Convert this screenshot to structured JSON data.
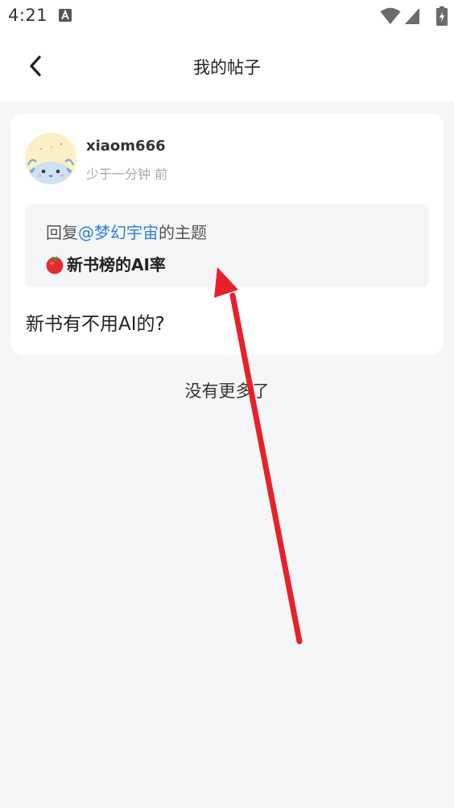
{
  "status_bar": {
    "time": "4:21",
    "icons": [
      "text-a-icon",
      "wifi-icon",
      "signal-icon",
      "battery-charging-icon"
    ]
  },
  "header": {
    "title": "我的帖子",
    "back_icon": "chevron-left-icon"
  },
  "post": {
    "username": "xiaom666",
    "time": "少于一分钟 前",
    "reply_prefix": "回复",
    "mention": "@梦幻宇宙",
    "reply_suffix": "的主题",
    "topic_icon": "tomato-icon",
    "topic_title": "新书榜的AI率",
    "content": "新书有不用AI的?"
  },
  "footer": {
    "no_more": "没有更多了"
  },
  "colors": {
    "background": "#f5f6f8",
    "card": "#ffffff",
    "mention": "#2f7fd8",
    "annotation_arrow": "#e8202a"
  }
}
